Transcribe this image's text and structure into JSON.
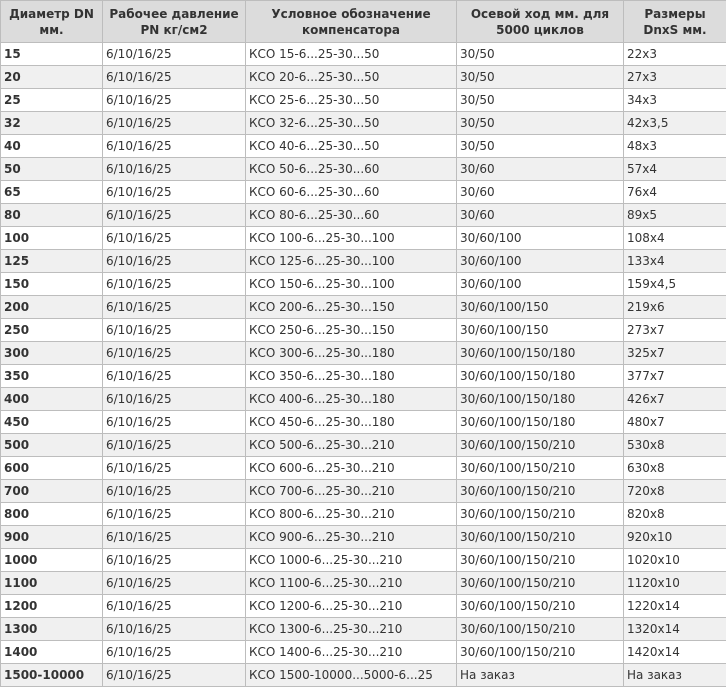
{
  "headers": [
    "Диаметр DN мм.",
    "Рабочее давление PN кг/см2",
    "Условное обозначение компенсатора",
    "Осевой ход мм. для 5000 циклов",
    "Размеры DnxS мм."
  ],
  "rows": [
    [
      "15",
      "6/10/16/25",
      "КСО  15-6...25-30...50",
      "30/50",
      "22x3"
    ],
    [
      "20",
      "6/10/16/25",
      "КСО 20-6...25-30...50",
      "30/50",
      "27x3"
    ],
    [
      "25",
      "6/10/16/25",
      "КСО  25-6...25-30...50",
      "30/50",
      "34x3"
    ],
    [
      "32",
      "6/10/16/25",
      "КСО 32-6...25-30...50",
      "30/50",
      "42x3,5"
    ],
    [
      "40",
      "6/10/16/25",
      "КСО  40-6...25-30...50",
      "30/50",
      "48x3"
    ],
    [
      "50",
      "6/10/16/25",
      "КСО  50-6...25-30...60",
      "30/60",
      "57x4"
    ],
    [
      "65",
      "6/10/16/25",
      "КСО  60-6...25-30...60",
      "30/60",
      "76x4"
    ],
    [
      "80",
      "6/10/16/25",
      "КСО  80-6...25-30...60",
      "30/60",
      "89x5"
    ],
    [
      "100",
      "6/10/16/25",
      "КСО  100-6...25-30...100",
      "30/60/100",
      "108x4"
    ],
    [
      "125",
      "6/10/16/25",
      "КСО  125-6...25-30...100",
      "30/60/100",
      "133x4"
    ],
    [
      "150",
      "6/10/16/25",
      "КСО  150-6...25-30...100",
      "30/60/100",
      "159x4,5"
    ],
    [
      "200",
      "6/10/16/25",
      "КСО  200-6...25-30...150",
      "30/60/100/150",
      "219x6"
    ],
    [
      "250",
      "6/10/16/25",
      "КСО  250-6...25-30...150",
      "30/60/100/150",
      "273x7"
    ],
    [
      "300",
      "6/10/16/25",
      "КСО 300-6...25-30...180",
      "30/60/100/150/180",
      "325x7"
    ],
    [
      "350",
      "6/10/16/25",
      "КСО  350-6...25-30...180",
      "30/60/100/150/180",
      "377x7"
    ],
    [
      "400",
      "6/10/16/25",
      "КСО  400-6...25-30...180",
      "30/60/100/150/180",
      "426x7"
    ],
    [
      "450",
      "6/10/16/25",
      "КСО  450-6...25-30...180",
      "30/60/100/150/180",
      "480x7"
    ],
    [
      "500",
      "6/10/16/25",
      "КСО  500-6...25-30...210",
      "30/60/100/150/210",
      "530x8"
    ],
    [
      "600",
      "6/10/16/25",
      "КСО  600-6...25-30...210",
      "30/60/100/150/210",
      "630x8"
    ],
    [
      "700",
      "6/10/16/25",
      "КСО  700-6...25-30...210",
      "30/60/100/150/210",
      "720x8"
    ],
    [
      "800",
      "6/10/16/25",
      "КСО  800-6...25-30...210",
      "30/60/100/150/210",
      "820x8"
    ],
    [
      "900",
      "6/10/16/25",
      "КСО 900-6...25-30...210",
      "30/60/100/150/210",
      "920x10"
    ],
    [
      "1000",
      "6/10/16/25",
      "КСО  1000-6...25-30...210",
      "30/60/100/150/210",
      "1020x10"
    ],
    [
      "1100",
      "6/10/16/25",
      "КСО  1100-6...25-30...210",
      "30/60/100/150/210",
      "1120x10"
    ],
    [
      "1200",
      "6/10/16/25",
      "КСО 1200-6...25-30...210",
      "30/60/100/150/210",
      "1220x14"
    ],
    [
      "1300",
      "6/10/16/25",
      "КСО 1300-6...25-30...210",
      "30/60/100/150/210",
      "1320x14"
    ],
    [
      "1400",
      "6/10/16/25",
      "КСО 1400-6...25-30...210",
      "30/60/100/150/210",
      "1420x14"
    ],
    [
      "1500-10000",
      "6/10/16/25",
      "КСО 1500-10000...5000-6...25",
      "На заказ",
      "На заказ"
    ]
  ]
}
